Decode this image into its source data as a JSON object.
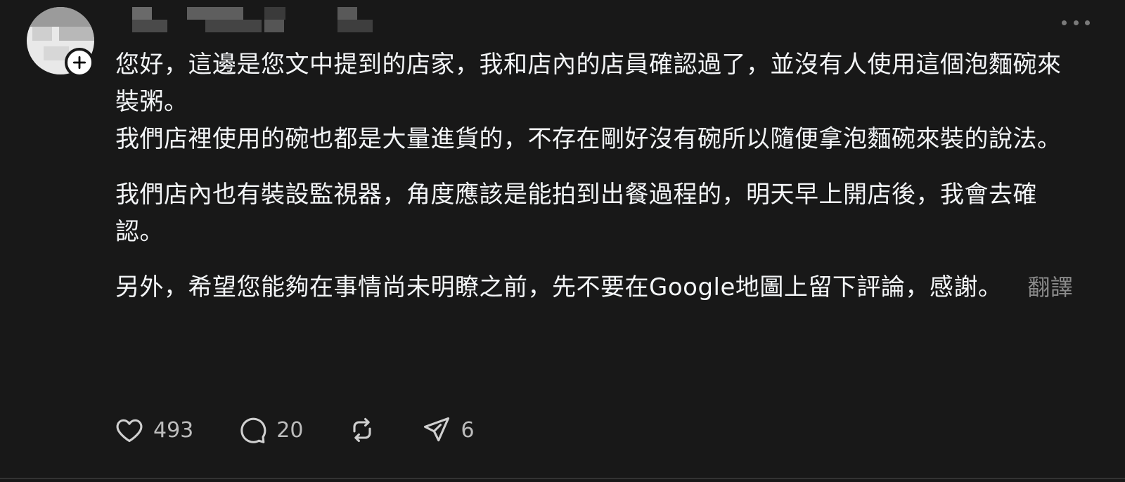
{
  "post": {
    "paragraphs": [
      [
        "您好，這邊是您文中提到的店家，我和店內的店員確認過了，並沒有人使用這個泡麵碗來裝粥。",
        "我們店裡使用的碗也都是大量進貨的，不存在剛好沒有碗所以隨便拿泡麵碗來裝的說法。"
      ],
      [
        "我們店內也有裝設監視器，角度應該是能拍到出餐過程的，明天早上開店後，我會去確認。"
      ],
      [
        "另外，希望您能夠在事情尚未明瞭之前，先不要在Google地圖上留下評論，感謝。"
      ]
    ],
    "translate_label": "翻譯"
  },
  "actions": {
    "like_count": "493",
    "comment_count": "20",
    "share_count": "6"
  },
  "icons": {
    "more": "more-horizontal-icon",
    "follow": "plus-icon",
    "like": "heart-icon",
    "comment": "comment-bubble-icon",
    "repost": "repost-icon",
    "share": "send-icon"
  },
  "colors": {
    "background": "#181818",
    "text": "#f3f5f7",
    "muted": "#8a8a8a"
  }
}
